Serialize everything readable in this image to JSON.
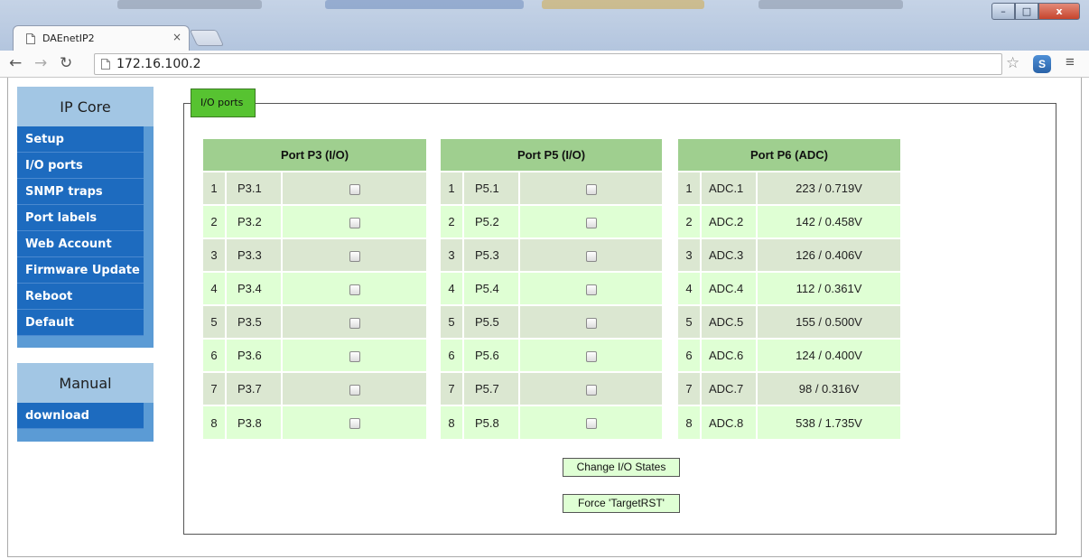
{
  "browser": {
    "tab_title": "DAEnetIP2",
    "tab_close": "×",
    "url": "172.16.100.2",
    "window_controls": {
      "minimize": "–",
      "maximize": "□",
      "close": "x"
    },
    "icons": {
      "back": "back-arrow-icon",
      "forward": "forward-arrow-icon",
      "reload": "reload-icon",
      "bookmark": "star-icon",
      "menu": "hamburger-menu-icon"
    }
  },
  "sidebar": {
    "title": "IP Core",
    "items": [
      {
        "label": "Setup"
      },
      {
        "label": "I/O ports"
      },
      {
        "label": "SNMP traps"
      },
      {
        "label": "Port labels"
      },
      {
        "label": "Web Account"
      },
      {
        "label": "Firmware Update"
      },
      {
        "label": "Reboot"
      },
      {
        "label": "Default"
      }
    ],
    "manual": {
      "title": "Manual",
      "items": [
        {
          "label": "download"
        }
      ]
    }
  },
  "main": {
    "legend": "I/O ports",
    "tables": [
      {
        "header": "Port P3 (I/O)",
        "rows": [
          {
            "n": "1",
            "name": "P3.1"
          },
          {
            "n": "2",
            "name": "P3.2"
          },
          {
            "n": "3",
            "name": "P3.3"
          },
          {
            "n": "4",
            "name": "P3.4"
          },
          {
            "n": "5",
            "name": "P3.5"
          },
          {
            "n": "6",
            "name": "P3.6"
          },
          {
            "n": "7",
            "name": "P3.7"
          },
          {
            "n": "8",
            "name": "P3.8"
          }
        ]
      },
      {
        "header": "Port P5 (I/O)",
        "rows": [
          {
            "n": "1",
            "name": "P5.1"
          },
          {
            "n": "2",
            "name": "P5.2"
          },
          {
            "n": "3",
            "name": "P5.3"
          },
          {
            "n": "4",
            "name": "P5.4"
          },
          {
            "n": "5",
            "name": "P5.5"
          },
          {
            "n": "6",
            "name": "P5.6"
          },
          {
            "n": "7",
            "name": "P5.7"
          },
          {
            "n": "8",
            "name": "P5.8"
          }
        ]
      },
      {
        "header": "Port P6 (ADC)",
        "rows": [
          {
            "n": "1",
            "name": "ADC.1",
            "value": "223 / 0.719V"
          },
          {
            "n": "2",
            "name": "ADC.2",
            "value": "142 / 0.458V"
          },
          {
            "n": "3",
            "name": "ADC.3",
            "value": "126 / 0.406V"
          },
          {
            "n": "4",
            "name": "ADC.4",
            "value": "112 / 0.361V"
          },
          {
            "n": "5",
            "name": "ADC.5",
            "value": "155 / 0.500V"
          },
          {
            "n": "6",
            "name": "ADC.6",
            "value": "124 / 0.400V"
          },
          {
            "n": "7",
            "name": "ADC.7",
            "value": "98 / 0.316V"
          },
          {
            "n": "8",
            "name": "ADC.8",
            "value": "538 / 1.735V"
          }
        ]
      }
    ],
    "buttons": {
      "change_states": "Change I/O States",
      "force_reset": "Force 'TargetRST'"
    }
  },
  "colors": {
    "sidebar_item": "#1d6bbf",
    "sidebar_header": "#a2c6e4",
    "table_header": "#9fcf8f",
    "row_odd": "#dbe7d1",
    "row_even": "#dfffd4",
    "legend": "#57c331"
  }
}
